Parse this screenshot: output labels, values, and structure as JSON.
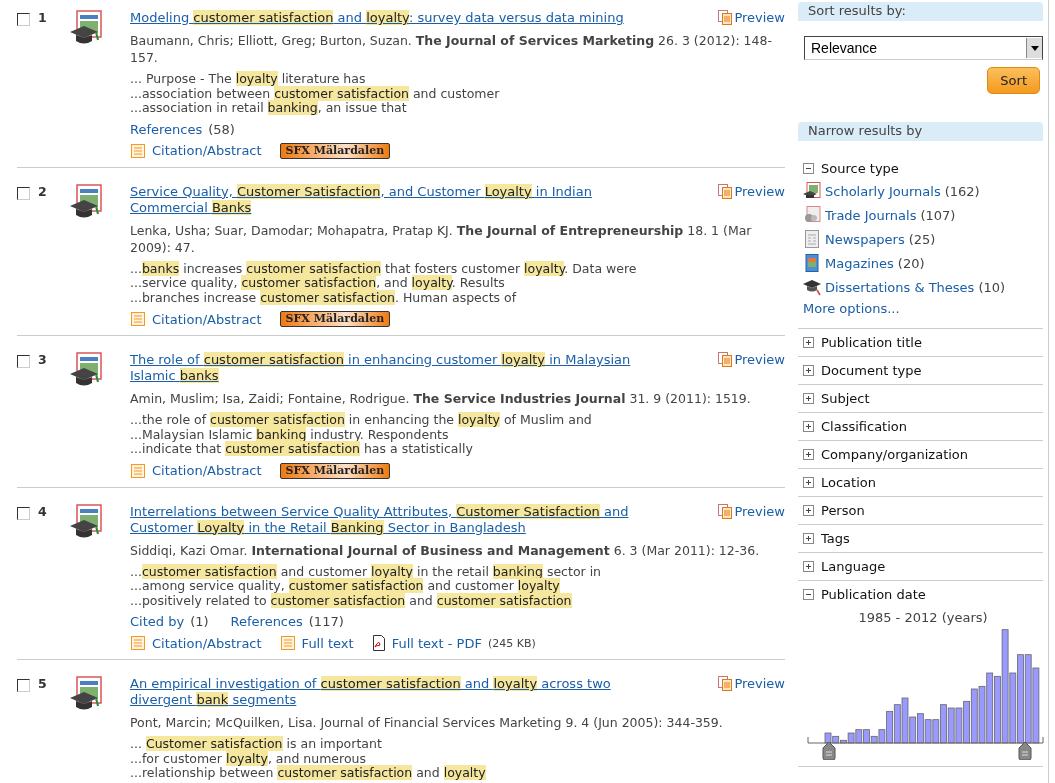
{
  "results": [
    {
      "number": "1",
      "checked": false,
      "title": [
        {
          "text": "Modeling ",
          "highlight": false
        },
        {
          "text": "customer satisfaction",
          "highlight": true
        },
        {
          "text": " and ",
          "highlight": false
        },
        {
          "text": "loyalty",
          "highlight": true
        },
        {
          "text": ": survey data versus data mining",
          "highlight": false
        }
      ],
      "preview": "Preview",
      "source": "Baumann, Chris; Elliott, Greg; Burton, Suzan. **The Journal of Services Marketing** 26. 3 (2012): 148-157.",
      "snippet": [
        [
          {
            "text": "... Purpose - The ",
            "highlight": false
          },
          {
            "text": "loyalty",
            "highlight": true
          },
          {
            "text": " literature has",
            "highlight": false
          }
        ],
        [
          {
            "text": "...association between ",
            "highlight": false
          },
          {
            "text": "customer satisfaction",
            "highlight": true
          },
          {
            "text": " and customer",
            "highlight": false
          }
        ],
        [
          {
            "text": "...association in retail ",
            "highlight": false
          },
          {
            "text": "banking",
            "highlight": true
          },
          {
            "text": ", an issue that",
            "highlight": false
          }
        ]
      ],
      "counts": [
        {
          "label": "References",
          "count": "(58)"
        }
      ],
      "links": [
        {
          "kind": "citation",
          "label": "Citation/Abstract"
        },
        {
          "kind": "sfx",
          "label": "SFX Mälardalen"
        }
      ]
    },
    {
      "number": "2",
      "checked": false,
      "title": [
        {
          "text": "Service Quality, ",
          "highlight": false
        },
        {
          "text": "Customer Satisfaction",
          "highlight": true
        },
        {
          "text": ", and Customer ",
          "highlight": false
        },
        {
          "text": "Loyalty",
          "highlight": true
        },
        {
          "text": " in Indian Commercial ",
          "highlight": false
        },
        {
          "text": "Banks",
          "highlight": true
        }
      ],
      "preview": "Preview",
      "source": "Lenka, Usha; Suar, Damodar; Mohapatra, Pratap KJ. **The Journal of Entrepreneurship** 18. 1 (Mar 2009): 47.",
      "snippet": [
        [
          {
            "text": "...",
            "highlight": false
          },
          {
            "text": "banks",
            "highlight": true
          },
          {
            "text": " increases ",
            "highlight": false
          },
          {
            "text": "customer satisfaction",
            "highlight": true
          },
          {
            "text": " that fosters customer ",
            "highlight": false
          },
          {
            "text": "loyalty",
            "highlight": true
          },
          {
            "text": ". Data were",
            "highlight": false
          }
        ],
        [
          {
            "text": "...service quality, ",
            "highlight": false
          },
          {
            "text": "customer satisfaction",
            "highlight": true
          },
          {
            "text": ", and ",
            "highlight": false
          },
          {
            "text": "loyalty",
            "highlight": true
          },
          {
            "text": ". Results",
            "highlight": false
          }
        ],
        [
          {
            "text": "...branches increase ",
            "highlight": false
          },
          {
            "text": "customer satisfaction",
            "highlight": true
          },
          {
            "text": ". Human aspects of",
            "highlight": false
          }
        ]
      ],
      "links": [
        {
          "kind": "citation",
          "label": "Citation/Abstract"
        },
        {
          "kind": "sfx",
          "label": "SFX Mälardalen"
        }
      ]
    },
    {
      "number": "3",
      "checked": false,
      "title": [
        {
          "text": "The role of ",
          "highlight": false
        },
        {
          "text": "customer satisfaction",
          "highlight": true
        },
        {
          "text": " in enhancing customer ",
          "highlight": false
        },
        {
          "text": "loyalty",
          "highlight": true
        },
        {
          "text": " in Malaysian Islamic ",
          "highlight": false
        },
        {
          "text": "banks",
          "highlight": true
        }
      ],
      "preview": "Preview",
      "source": "Amin, Muslim; Isa, Zaidi; Fontaine, Rodrigue. **The Service Industries Journal** 31. 9 (2011): 1519.",
      "snippet": [
        [
          {
            "text": "...the role of ",
            "highlight": false
          },
          {
            "text": "customer satisfaction",
            "highlight": true
          },
          {
            "text": " in enhancing the ",
            "highlight": false
          },
          {
            "text": "loyalty",
            "highlight": true
          },
          {
            "text": " of Muslim and",
            "highlight": false
          }
        ],
        [
          {
            "text": "...Malaysian Islamic ",
            "highlight": false
          },
          {
            "text": "banking",
            "highlight": true
          },
          {
            "text": " industry. Respondents",
            "highlight": false
          }
        ],
        [
          {
            "text": "...indicate that ",
            "highlight": false
          },
          {
            "text": "customer satisfaction",
            "highlight": true
          },
          {
            "text": " has a statistically",
            "highlight": false
          }
        ]
      ],
      "links": [
        {
          "kind": "citation",
          "label": "Citation/Abstract"
        },
        {
          "kind": "sfx",
          "label": "SFX Mälardalen"
        }
      ]
    },
    {
      "number": "4",
      "checked": false,
      "title": [
        {
          "text": "Interrelations between Service Quality Attributes, ",
          "highlight": false
        },
        {
          "text": "Customer Satisfaction",
          "highlight": true
        },
        {
          "text": " and Customer ",
          "highlight": false
        },
        {
          "text": "Loyalty",
          "highlight": true
        },
        {
          "text": " in the Retail ",
          "highlight": false
        },
        {
          "text": "Banking",
          "highlight": true
        },
        {
          "text": " Sector in Bangladesh",
          "highlight": false
        }
      ],
      "preview": "Preview",
      "source": "Siddiqi, Kazi Omar. **International Journal of Business and Management** 6. 3 (Mar 2011): 12-36.",
      "snippet": [
        [
          {
            "text": "...",
            "highlight": false
          },
          {
            "text": "customer satisfaction",
            "highlight": true
          },
          {
            "text": " and customer ",
            "highlight": false
          },
          {
            "text": "loyalty",
            "highlight": true
          },
          {
            "text": " in the retail ",
            "highlight": false
          },
          {
            "text": "banking",
            "highlight": true
          },
          {
            "text": " sector in",
            "highlight": false
          }
        ],
        [
          {
            "text": "...among service quality, ",
            "highlight": false
          },
          {
            "text": "customer satisfaction",
            "highlight": true
          },
          {
            "text": " and customer ",
            "highlight": false
          },
          {
            "text": "loyalty",
            "highlight": true
          }
        ],
        [
          {
            "text": "...positively related to ",
            "highlight": false
          },
          {
            "text": "customer satisfaction",
            "highlight": true
          },
          {
            "text": " and ",
            "highlight": false
          },
          {
            "text": "customer satisfaction",
            "highlight": true
          }
        ]
      ],
      "counts": [
        {
          "label": "Cited by",
          "count": "(1)"
        },
        {
          "label": "References",
          "count": "(117)"
        }
      ],
      "links": [
        {
          "kind": "citation",
          "label": "Citation/Abstract"
        },
        {
          "kind": "fulltext",
          "label": "Full text"
        },
        {
          "kind": "pdf",
          "label": "Full text - PDF",
          "size": "(245 KB)"
        }
      ]
    },
    {
      "number": "5",
      "checked": false,
      "title": [
        {
          "text": "An empirical investigation of ",
          "highlight": false
        },
        {
          "text": "customer satisfaction",
          "highlight": true
        },
        {
          "text": " and ",
          "highlight": false
        },
        {
          "text": "loyalty",
          "highlight": true
        },
        {
          "text": " across two divergent ",
          "highlight": false
        },
        {
          "text": "bank",
          "highlight": true
        },
        {
          "text": " segments",
          "highlight": false
        }
      ],
      "preview": "Preview",
      "source": "Pont, Marcin; McQuilken, Lisa. Journal of Financial Services Marketing 9. 4 (Jun 2005): 344-359.",
      "snippet": [
        [
          {
            "text": "... ",
            "highlight": false
          },
          {
            "text": "Customer satisfaction",
            "highlight": true
          },
          {
            "text": " is an important",
            "highlight": false
          }
        ],
        [
          {
            "text": "...for customer ",
            "highlight": false
          },
          {
            "text": "loyalty",
            "highlight": true
          },
          {
            "text": ", and numerous",
            "highlight": false
          }
        ],
        [
          {
            "text": "...relationship between ",
            "highlight": false
          },
          {
            "text": "customer satisfaction",
            "highlight": true
          },
          {
            "text": " and ",
            "highlight": false
          },
          {
            "text": "loyalty",
            "highlight": true
          }
        ]
      ]
    }
  ],
  "sidebar": {
    "sort_header": "Sort results by:",
    "sort_select": "Relevance",
    "sort_button": "Sort",
    "narrow_header": "Narrow results by",
    "facets": [
      {
        "label": "Source type",
        "expanded": true,
        "items": [
          {
            "kind": "scholarly",
            "label": "Scholarly Journals",
            "count": "(162)"
          },
          {
            "kind": "trade",
            "label": "Trade Journals",
            "count": "(107)"
          },
          {
            "kind": "newspaper",
            "label": "Newspapers",
            "count": "(25)"
          },
          {
            "kind": "magazine",
            "label": "Magazines",
            "count": "(20)"
          },
          {
            "kind": "dissertation",
            "label": "Dissertations & Theses",
            "count": "(10)"
          }
        ],
        "more": "More options..."
      },
      {
        "label": "Publication title",
        "expanded": false
      },
      {
        "label": "Document type",
        "expanded": false
      },
      {
        "label": "Subject",
        "expanded": false
      },
      {
        "label": "Classification",
        "expanded": false
      },
      {
        "label": "Company/organization",
        "expanded": false
      },
      {
        "label": "Location",
        "expanded": false
      },
      {
        "label": "Person",
        "expanded": false
      },
      {
        "label": "Tags",
        "expanded": false
      },
      {
        "label": "Language",
        "expanded": false
      },
      {
        "label": "Publication date",
        "expanded": true,
        "range": "1985 - 2012 (years)"
      }
    ]
  }
}
